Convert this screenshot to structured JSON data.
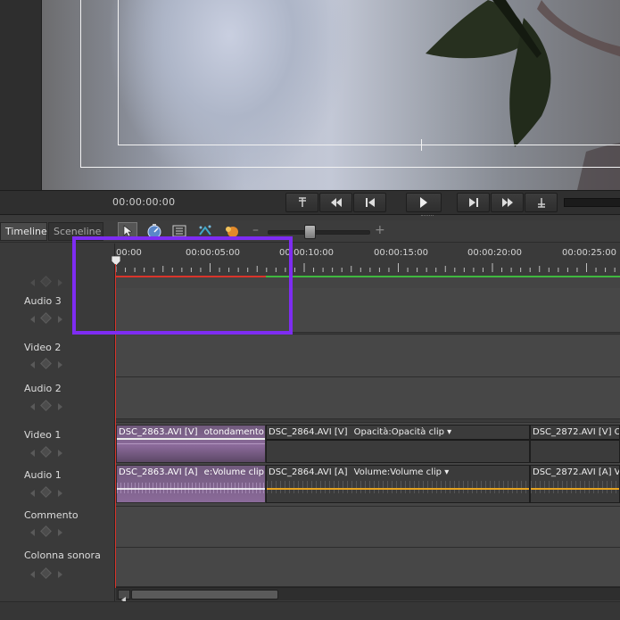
{
  "transport": {
    "timecode": "00:00:00:00",
    "buttons": [
      "goto-in-icon",
      "step-back-fast-icon",
      "step-back-frame-icon",
      "play-icon",
      "step-forward-frame-icon",
      "step-forward-fast-icon",
      "goto-out-icon"
    ]
  },
  "tabs": {
    "timeline": "Timeline",
    "sceneline": "Sceneline"
  },
  "toolbar": {
    "zoom_minus": "–",
    "zoom_plus": "+",
    "zoom_level": 0.37
  },
  "ruler": {
    "labels": [
      "00:00",
      "00:00:05:00",
      "00:00:10:00",
      "00:00:15:00",
      "00:00:20:00",
      "00:00:25:00"
    ]
  },
  "tracks": [
    {
      "name": "Audio 3"
    },
    {
      "name": "Video 2"
    },
    {
      "name": "Audio 2"
    },
    {
      "name": "Video 1"
    },
    {
      "name": "Audio 1"
    },
    {
      "name": "Commento"
    },
    {
      "name": "Colonna sonora"
    }
  ],
  "clips": {
    "v1": [
      {
        "file": "DSC_2863.AVI [V]",
        "fx": "otondamento"
      },
      {
        "file": "DSC_2864.AVI [V]",
        "fx": "Opacità:Opacità clip"
      },
      {
        "file": "DSC_2872.AVI [V]",
        "fx": "O"
      }
    ],
    "a1": [
      {
        "file": "DSC_2863.AVI [A]",
        "fx": "e:Volume clip"
      },
      {
        "file": "DSC_2864.AVI [A]",
        "fx": "Volume:Volume clip"
      },
      {
        "file": "DSC_2872.AVI [A]",
        "fx": "Vo"
      }
    ]
  },
  "colors": {
    "highlight": "#7e2cf2",
    "cti": "#d9342b",
    "workarea": "#3fb83f",
    "volume": "#e5a321",
    "clip_selected": "#8b6a9a"
  }
}
